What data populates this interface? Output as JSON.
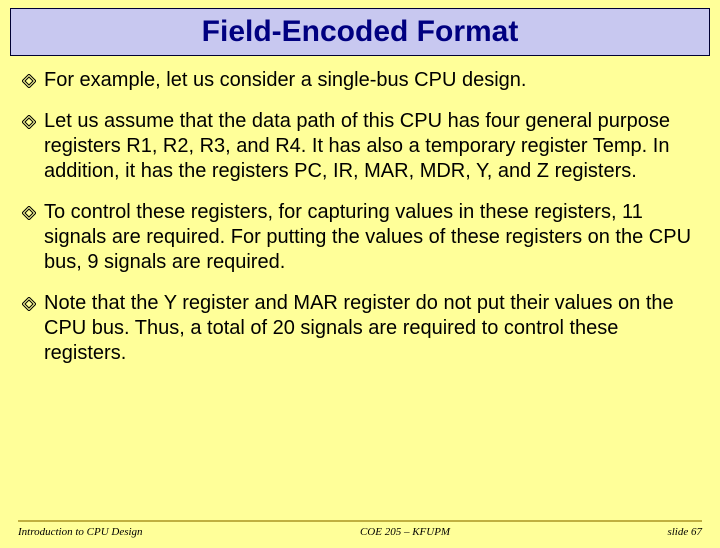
{
  "title": "Field-Encoded Format",
  "bullets": [
    "For example, let us consider a single-bus CPU design.",
    "Let us assume that the data path of this CPU has four general purpose registers R1, R2, R3, and R4. It has also a temporary register Temp. In addition, it has the registers PC, IR, MAR, MDR, Y, and Z registers.",
    "To control these registers, for capturing values in these registers, 11 signals are required. For putting the values of these registers on the CPU bus, 9 signals are required.",
    "Note that the Y register and MAR register do not put their values on the CPU bus. Thus, a total of 20 signals are required to control these registers."
  ],
  "footer": {
    "left": "Introduction to CPU Design",
    "center": "COE 205 – KFUPM",
    "right": "slide 67"
  }
}
